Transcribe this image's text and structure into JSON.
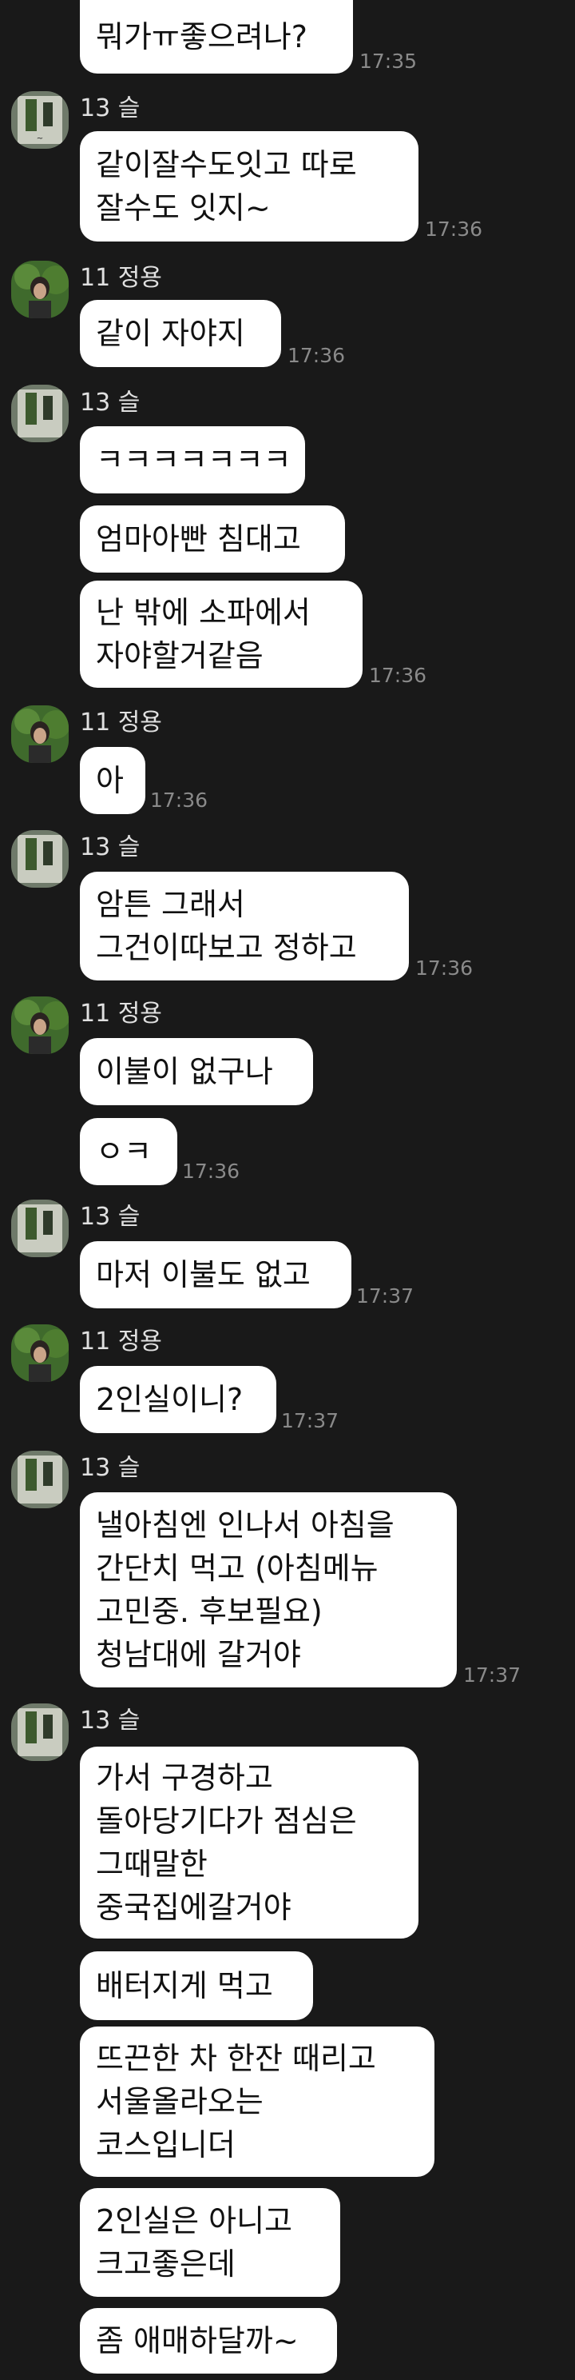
{
  "senders": {
    "seul": {
      "name": "13 슬"
    },
    "jeongyong": {
      "name": "11 정용"
    }
  },
  "messages": [
    {
      "text": "뭐가ㅠ좋으려나?",
      "time": "17:35"
    },
    {
      "text": "같이잘수도잇고 따로\n잘수도 잇지~",
      "time": "17:36"
    },
    {
      "text": "같이 자야지",
      "time": "17:36"
    },
    {
      "text": "ㅋㅋㅋㅋㅋㅋㅋ",
      "time": ""
    },
    {
      "text": "엄마아빤 침대고",
      "time": ""
    },
    {
      "text": "난 밖에 소파에서\n자야할거같음",
      "time": "17:36"
    },
    {
      "text": "아",
      "time": "17:36"
    },
    {
      "text": "암튼 그래서\n그건이따보고 정하고",
      "time": "17:36"
    },
    {
      "text": "이불이 없구나",
      "time": ""
    },
    {
      "text": "ㅇㅋ",
      "time": "17:36"
    },
    {
      "text": "마저 이불도 없고",
      "time": "17:37"
    },
    {
      "text": "2인실이니?",
      "time": "17:37"
    },
    {
      "text": "낼아침엔 인나서 아침을\n간단치 먹고 (아침메뉴\n고민중. 후보필요)\n청남대에 갈거야",
      "time": "17:37"
    },
    {
      "text": "가서 구경하고\n돌아당기다가 점심은\n그때말한\n중국집에갈거야",
      "time": ""
    },
    {
      "text": "배터지게 먹고",
      "time": ""
    },
    {
      "text": "뜨끈한 차 한잔 때리고\n서울올라오는\n코스입니더",
      "time": ""
    },
    {
      "text": "2인실은 아니고\n크고좋은데",
      "time": ""
    },
    {
      "text": "좀 애매하달까~",
      "time": ""
    }
  ]
}
